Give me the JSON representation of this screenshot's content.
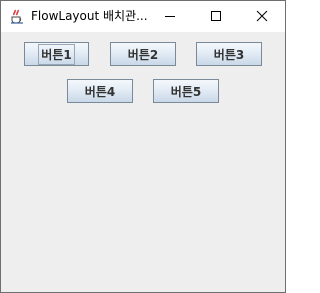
{
  "window": {
    "title": "FlowLayout 배치관..."
  },
  "buttons": [
    {
      "label": "버튼1"
    },
    {
      "label": "버튼2"
    },
    {
      "label": "버튼3"
    },
    {
      "label": "버튼4"
    },
    {
      "label": "버튼5"
    }
  ],
  "icons": {
    "app": "java-cup-icon",
    "minimize": "minimize-icon",
    "maximize": "maximize-icon",
    "close": "close-icon"
  }
}
